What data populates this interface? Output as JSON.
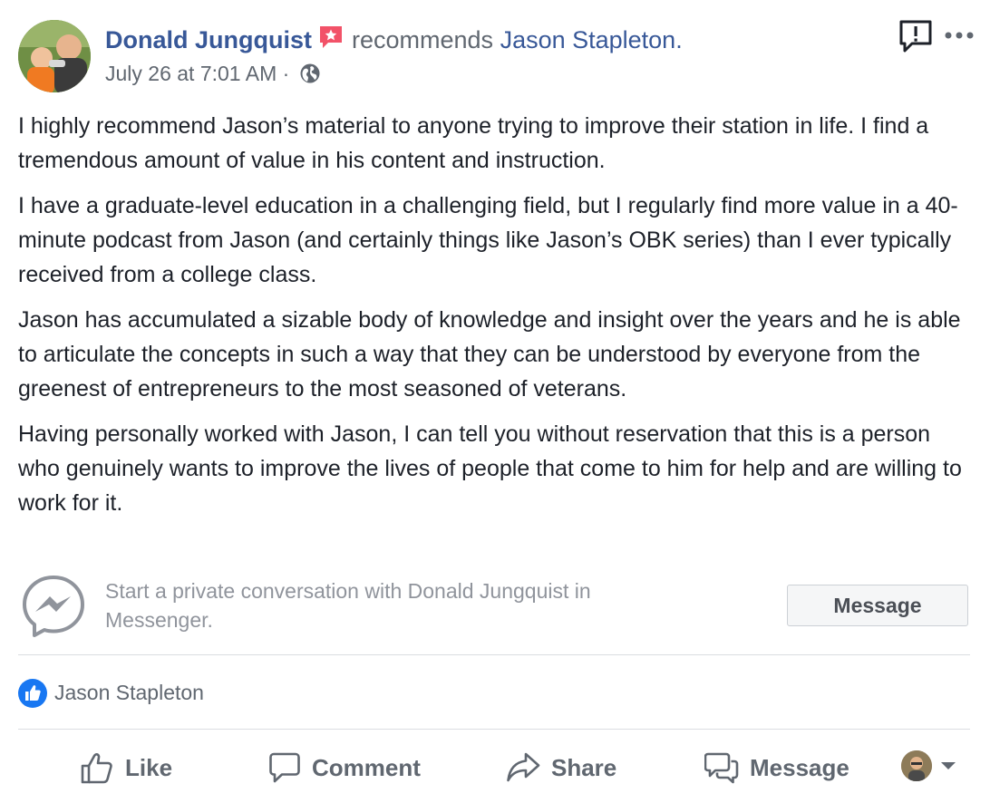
{
  "post": {
    "author": "Donald Jungquist",
    "recommends_text": "recommends",
    "recommended_page": "Jason Stapleton.",
    "timestamp": "July 26 at 7:01 AM",
    "separator": "·",
    "privacy_icon": "globe-icon",
    "paragraphs": [
      "I highly recommend Jason’s material to anyone trying to improve their station in life. I find a tremendous amount of value in his content and instruction.",
      "I have a graduate-level education in a challenging field, but I regularly find more value in a 40-minute podcast from Jason (and certainly things like Jason’s OBK series) than I ever typically received from a college class.",
      "Jason has accumulated a sizable body of knowledge and insight over the years and he is able to articulate the concepts in such a way that they can be understood by everyone from the greenest of entrepreneurs to the most seasoned of veterans.",
      "Having personally worked with Jason, I can tell you without reservation that this is a person who genuinely wants to improve the lives of people that come to him for help and are willing to work for it."
    ]
  },
  "messenger_prompt": {
    "text": "Start a private conversation with Donald Jungquist in Messenger.",
    "button_label": "Message"
  },
  "reactions": {
    "likers": "Jason Stapleton"
  },
  "actions": {
    "like": "Like",
    "comment": "Comment",
    "share": "Share",
    "message": "Message"
  },
  "colors": {
    "link": "#385898",
    "meta": "#606770",
    "like_blue": "#1877f2",
    "recommend_red": "#f25268"
  }
}
